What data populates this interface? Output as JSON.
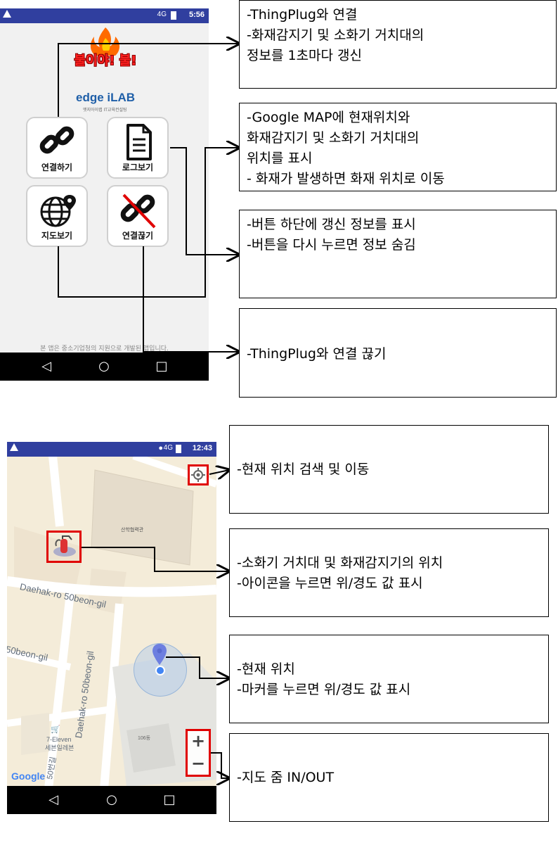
{
  "phone1": {
    "status_time": "5:56",
    "status_signal": "4G",
    "logo_text": "불이야! 불!",
    "brand": "edge iLAB",
    "brand_sub": "엣지아이랩 IT교육컨설팅",
    "buttons": {
      "connect": "연결하기",
      "log": "로그보기",
      "map": "지도보기",
      "disconnect": "연결끊기"
    },
    "footer": "본 앱은 중소기업청의 지원으로 개발된 앱입니다."
  },
  "phone2": {
    "status_time": "12:43",
    "status_signal": "4G",
    "building_label": "산학협력관",
    "road1": "Daehak-ro 50beon-gil",
    "road2": "Daehak-ro 50beon-gil",
    "road3": "50beon-gil",
    "store_label1": "7-Eleven",
    "store_label2": "세븐일레븐",
    "building2_label": "106동",
    "road4": "50번길",
    "google_logo": "Google",
    "zoom_in": "+",
    "zoom_out": "−"
  },
  "annotations": {
    "connect_desc": "-ThingPlug와 연결\n-화재감지기 및 소화기 거치대의\n정보를 1초마다 갱신",
    "map_desc": "-Google MAP에 현재위치와\n화재감지기 및 소화기 거치대의\n위치를 표시\n- 화재가 발생하면 화재 위치로 이동",
    "log_desc": "-버튼 하단에 갱신 정보를 표시\n-버튼을 다시 누르면 정보 숨김",
    "disconnect_desc": "-ThingPlug와 연결 끊기",
    "locate_desc": "-현재 위치 검색 및 이동",
    "marker_desc": "-소화기 거치대 및 화재감지기의 위치\n-아이콘을 누르면 위/경도 값 표시",
    "current_desc": "-현재 위치\n-마커를 누르면 위/경도 값 표시",
    "zoom_desc": "-지도 줌 IN/OUT"
  },
  "colors": {
    "status_bar": "#303f9f",
    "highlight": "#e00000",
    "map_bg": "#f2ead6",
    "location_blue": "#4285f4"
  }
}
